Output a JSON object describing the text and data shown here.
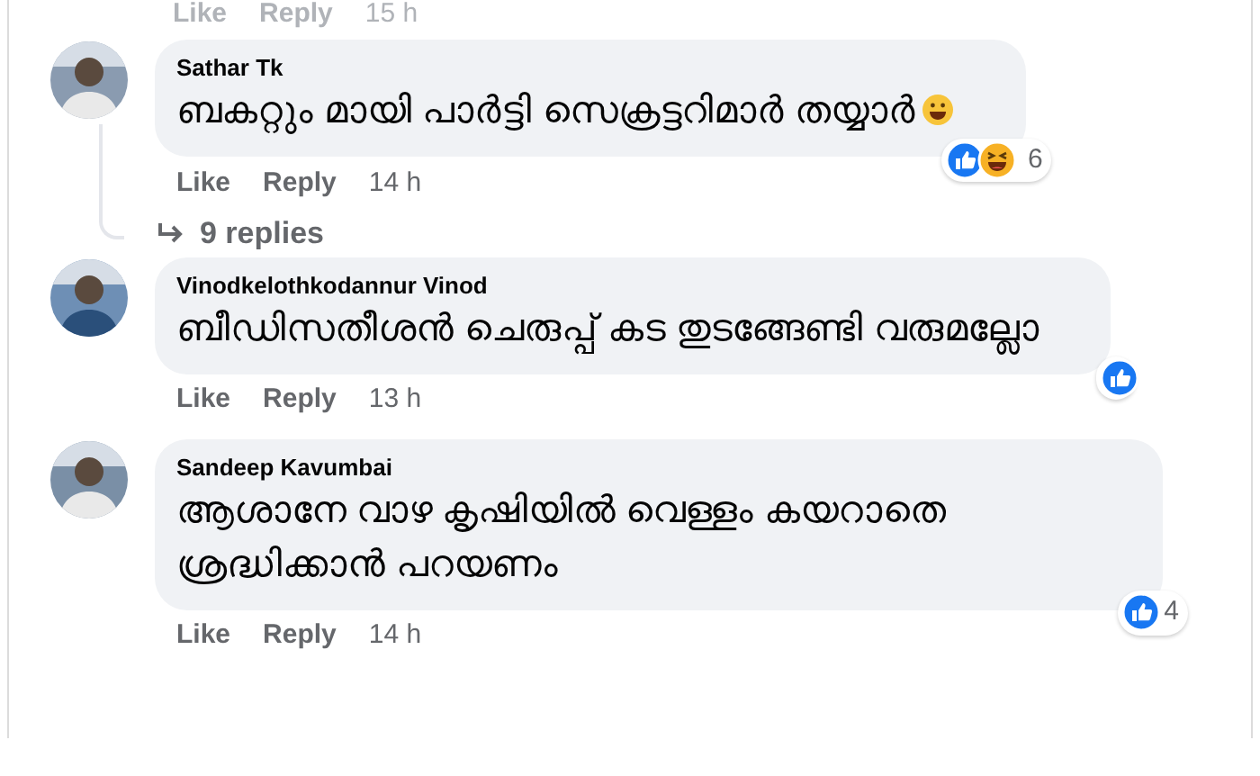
{
  "top_actions": {
    "like": "Like",
    "reply": "Reply",
    "time": "15 h"
  },
  "comments": [
    {
      "name": "Sathar Tk",
      "text": "ബകറ്റും മായി പാർട്ടി സെക്രട്ടറിമാർ തയ്യാർ",
      "emoji": true,
      "reactions": [
        {
          "kind": "like"
        },
        {
          "kind": "haha"
        }
      ],
      "count": "6",
      "like": "Like",
      "reply": "Reply",
      "time": "14 h",
      "replies": "9 replies"
    },
    {
      "name": "Vinodkelothkodannur Vinod",
      "text": "ബീഡിസതീശൻ ചെരുപ്പ് കട തുടങ്ങേണ്ടി വരുമല്ലോ",
      "reactions": [
        {
          "kind": "like"
        }
      ],
      "like": "Like",
      "reply": "Reply",
      "time": "13 h"
    },
    {
      "name": "Sandeep Kavumbai",
      "text": "ആശാനേ വാഴ കൃഷിയിൽ വെള്ളം കയറാതെ ശ്രദ്ധിക്കാൻ പറയണം",
      "reactions": [
        {
          "kind": "like"
        }
      ],
      "count": "4",
      "like": "Like",
      "reply": "Reply",
      "time": "14 h"
    }
  ]
}
